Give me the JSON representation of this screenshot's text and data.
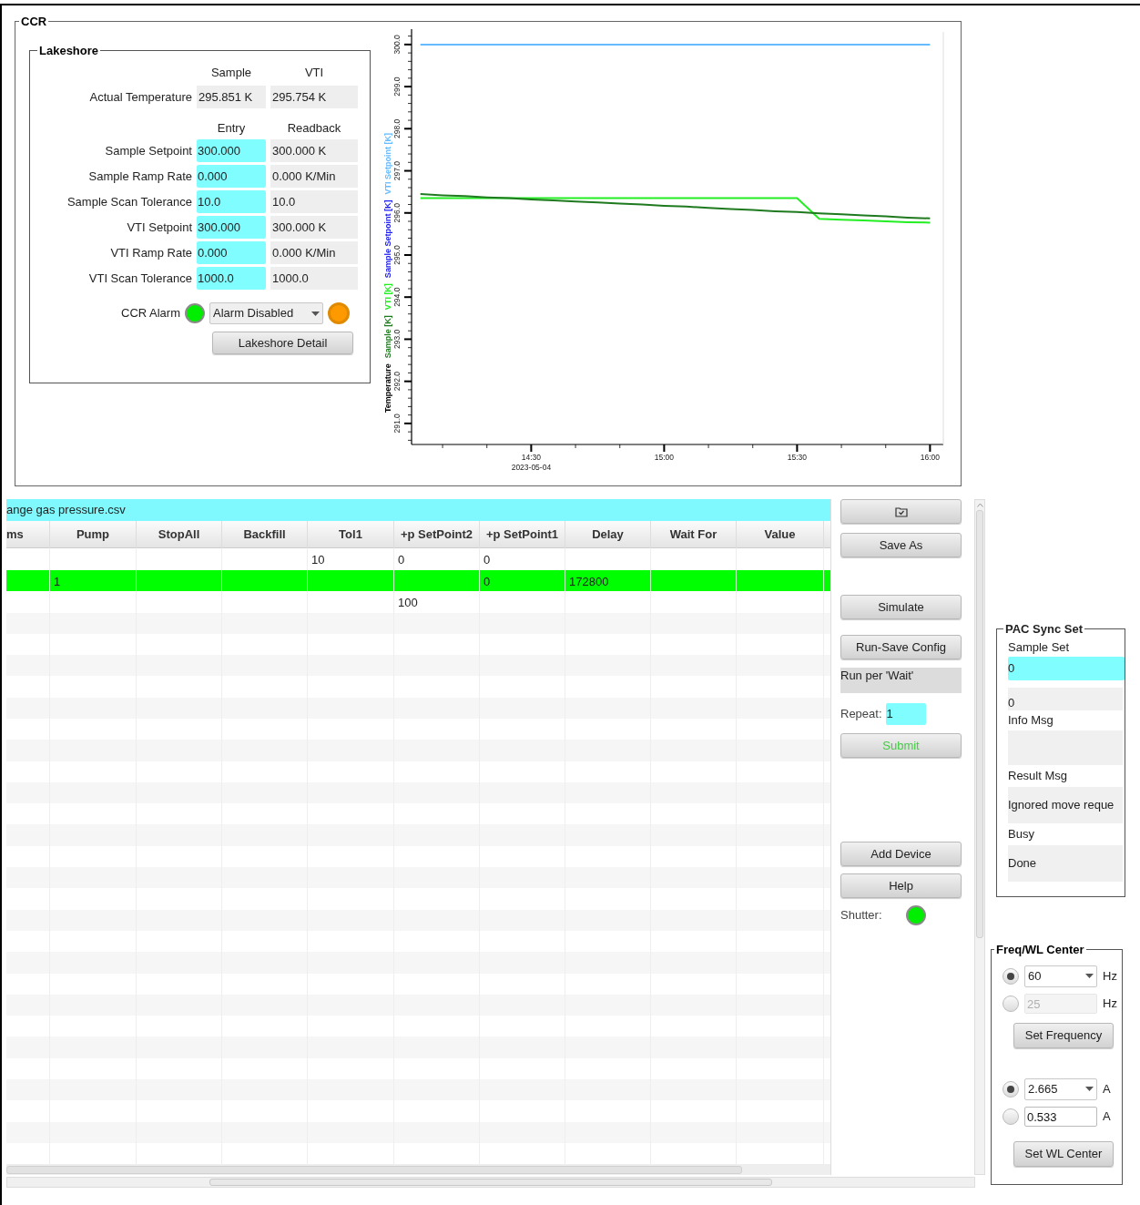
{
  "ccr": {
    "title": "CCR",
    "lakeshore": {
      "title": "Lakeshore",
      "actual": {
        "headers": [
          "Sample",
          "VTI"
        ],
        "label": "Actual Temperature",
        "values": [
          "295.851 K",
          "295.754 K"
        ]
      },
      "setting_headers": [
        "Entry",
        "Readback"
      ],
      "settings": [
        {
          "label": "Sample Setpoint",
          "entry": "300.000",
          "readback": "300.000 K"
        },
        {
          "label": "Sample Ramp Rate",
          "entry": "0.000",
          "readback": "0.000 K/Min"
        },
        {
          "label": "Sample Scan Tolerance",
          "entry": "10.0",
          "readback": "10.0"
        },
        {
          "label": "VTI Setpoint",
          "entry": "300.000",
          "readback": "300.000 K"
        },
        {
          "label": "VTI Ramp Rate",
          "entry": "0.000",
          "readback": "0.000 K/Min"
        },
        {
          "label": "VTI Scan Tolerance",
          "entry": "1000.0",
          "readback": "1000.0"
        }
      ],
      "alarm": {
        "label": "CCR Alarm",
        "status_led": {
          "color": "#00ee00"
        },
        "mode": "Alarm Disabled",
        "indicator_led": {
          "color": "#ff9900"
        }
      },
      "detail_button": "Lakeshore Detail"
    },
    "chart": {
      "chart_data": {
        "type": "line",
        "ylabel": "Temperature",
        "categories": [
          null,
          null,
          null,
          null,
          null,
          "14:30",
          null,
          null,
          null,
          null,
          null,
          "15:00",
          null,
          null,
          null,
          null,
          null,
          "15:30",
          null,
          null,
          null,
          null,
          null,
          "16:00"
        ],
        "ylim": [
          290.5,
          300.3
        ],
        "yticks": [
          {
            "value": 291,
            "label": "291.0"
          },
          {
            "value": 292,
            "label": "292.0"
          },
          {
            "value": 293,
            "label": "293.0"
          },
          {
            "value": 294,
            "label": "294.0"
          },
          {
            "value": 295,
            "label": "295.0"
          },
          {
            "value": 296,
            "label": "296.0"
          },
          {
            "value": 297,
            "label": "297.0"
          },
          {
            "value": 298,
            "label": "298.0"
          },
          {
            "value": 299,
            "label": "299.0"
          },
          {
            "value": 300,
            "label": "300.0"
          }
        ],
        "annotations": [
          "2023-05-04"
        ],
        "series": [
          {
            "name": "Sample [K]",
            "color": "#1f7a1f",
            "values": [
              296.45,
              296.42,
              296.4,
              296.37,
              296.35,
              296.32,
              296.3,
              296.27,
              296.25,
              296.22,
              296.2,
              296.17,
              296.15,
              296.12,
              296.09,
              296.07,
              296.04,
              296.02,
              295.99,
              295.97,
              295.94,
              295.92,
              295.89,
              295.87
            ]
          },
          {
            "name": "VTI [K]",
            "color": "#22ee22",
            "values": [
              296.35,
              296.35,
              296.35,
              296.35,
              296.35,
              296.35,
              296.35,
              296.35,
              296.35,
              296.35,
              296.35,
              296.35,
              296.35,
              296.35,
              296.35,
              296.35,
              296.35,
              296.35,
              295.86,
              295.84,
              295.82,
              295.8,
              295.78,
              295.77
            ]
          },
          {
            "name": "Sample Setpoint [K]",
            "color": "#2020ee",
            "values": [
              null,
              null,
              null,
              null,
              null,
              null,
              null,
              null,
              null,
              null,
              null,
              null,
              null,
              null,
              null,
              null,
              null,
              null,
              null,
              null,
              null,
              null,
              null,
              null
            ]
          },
          {
            "name": "VTI Setpoint [K]",
            "color": "#66bbff",
            "values": [
              300.0,
              300.0,
              300.0,
              300.0,
              300.0,
              300.0,
              300.0,
              300.0,
              300.0,
              300.0,
              300.0,
              300.0,
              300.0,
              300.0,
              300.0,
              300.0,
              300.0,
              300.0,
              300.0,
              300.0,
              300.0,
              300.0,
              300.0,
              300.0
            ]
          }
        ]
      }
    }
  },
  "sequence": {
    "file_name": "ange gas pressure.csv",
    "columns": [
      "ms",
      "Pump",
      "StopAll",
      "Backfill",
      "Tol1",
      "+p SetPoint2",
      "+p SetPoint1",
      "Delay",
      "Wait For",
      "Value"
    ],
    "rows": [
      {
        "selected": false,
        "cells": [
          null,
          null,
          null,
          null,
          "10",
          "0",
          "0",
          null,
          null,
          null
        ]
      },
      {
        "selected": true,
        "cells": [
          null,
          "1",
          null,
          null,
          null,
          null,
          "0",
          "172800",
          null,
          null
        ]
      },
      {
        "selected": false,
        "cells": [
          null,
          null,
          null,
          null,
          null,
          "100",
          null,
          null,
          null,
          null
        ]
      }
    ]
  },
  "controls": {
    "save_as": "Save As",
    "simulate": "Simulate",
    "run_save_config": "Run-Save Config",
    "run_mode": "Run per 'Wait'",
    "repeat_label": "Repeat:",
    "repeat_value": "1",
    "submit": "Submit",
    "add_device": "Add Device",
    "help": "Help",
    "shutter_label": "Shutter:",
    "shutter_led": {
      "color": "#00ee00"
    }
  },
  "pac_sync": {
    "title": "PAC Sync Set",
    "sample_set_label": "Sample Set",
    "sample_set_entry": "0",
    "sample_set_readback": "0",
    "info_label": "Info Msg",
    "result_label": "Result Msg",
    "result_value": "Ignored move reque",
    "busy_label": "Busy",
    "busy_value": "Done"
  },
  "freq_wl": {
    "title": "Freq/WL Center",
    "frequency": [
      {
        "selected": true,
        "kind": "dropdown",
        "value": "60",
        "unit": "Hz"
      },
      {
        "selected": false,
        "kind": "field",
        "value": "25",
        "unit": "Hz",
        "disabled": true
      }
    ],
    "set_frequency": "Set Frequency",
    "wavelength": [
      {
        "selected": true,
        "kind": "dropdown",
        "value": "2.665",
        "unit": "A"
      },
      {
        "selected": false,
        "kind": "field",
        "value": "0.533",
        "unit": "A",
        "disabled": false
      }
    ],
    "set_wl_center": "Set WL Center"
  }
}
